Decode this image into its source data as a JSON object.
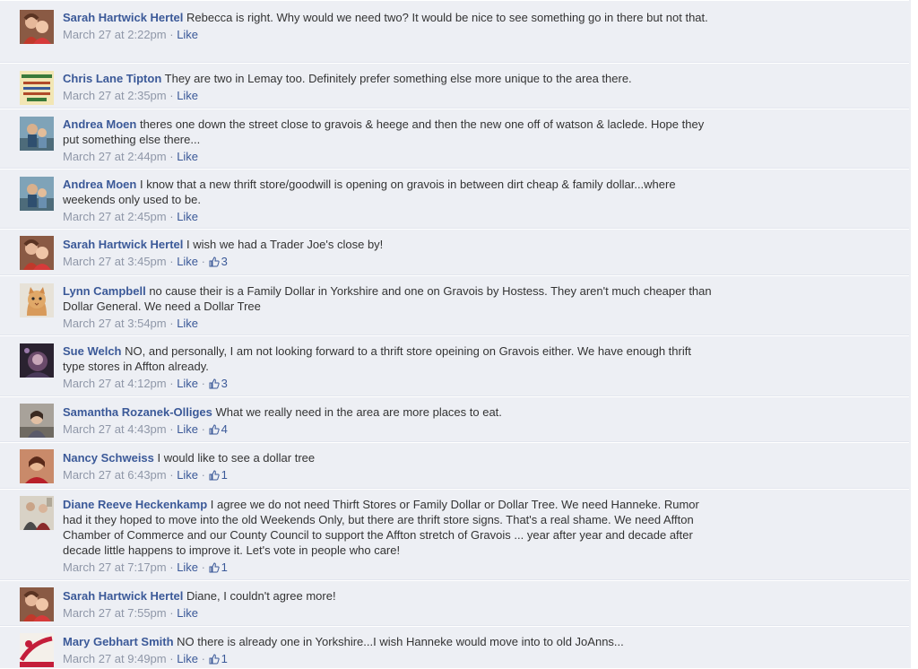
{
  "colors": {
    "background": "#edeff4",
    "author": "#3b5998",
    "text": "#333333",
    "meta": "#8f97a8"
  },
  "comments": [
    {
      "author": "Sarah Hartwick Hertel",
      "text": "Rebecca is right. Why would we need two? It would be nice to see something go in there but not that.",
      "time": "March 27 at 2:22pm",
      "sep": " · ",
      "like": "Like",
      "likes": "",
      "avatar": "sarah-avatar"
    },
    {
      "author": "Chris Lane Tipton",
      "text": "They are two in Lemay too. Definitely prefer something else more unique to the area there.",
      "time": "March 27 at 2:35pm",
      "sep": " · ",
      "like": "Like",
      "likes": "",
      "avatar": "chris-avatar"
    },
    {
      "author": "Andrea Moen",
      "text": "theres one down the street close to gravois & heege and then the new one off of watson & laclede. Hope they put something else there...",
      "time": "March 27 at 2:44pm",
      "sep": " · ",
      "like": "Like",
      "likes": "",
      "avatar": "andrea-avatar"
    },
    {
      "author": "Andrea Moen",
      "text": "I know that a new thrift store/goodwill is opening on gravois in between dirt cheap & family dollar...where weekends only used to be.",
      "time": "March 27 at 2:45pm",
      "sep": " · ",
      "like": "Like",
      "likes": "",
      "avatar": "andrea-avatar"
    },
    {
      "author": "Sarah Hartwick Hertel",
      "text": "I wish we had a Trader Joe's close by!",
      "time": "March 27 at 3:45pm",
      "sep": " · ",
      "like": "Like",
      "likes": "3",
      "avatar": "sarah-avatar"
    },
    {
      "author": "Lynn Campbell",
      "text": "no cause their is a Family Dollar in Yorkshire and one on Gravois by Hostess. They aren't much cheaper than Dollar General. We need a Dollar Tree",
      "time": "March 27 at 3:54pm",
      "sep": " · ",
      "like": "Like",
      "likes": "",
      "avatar": "lynn-avatar"
    },
    {
      "author": "Sue Welch",
      "text": "NO, and personally, I am not looking forward to a thrift store opeining on Gravois either. We have enough thrift type stores in Affton already.",
      "time": "March 27 at 4:12pm",
      "sep": " · ",
      "like": "Like",
      "likes": "3",
      "avatar": "sue-avatar"
    },
    {
      "author": "Samantha Rozanek-Olliges",
      "text": "What we really need in the area are more places to eat.",
      "time": "March 27 at 4:43pm",
      "sep": " · ",
      "like": "Like",
      "likes": "4",
      "avatar": "samantha-avatar"
    },
    {
      "author": "Nancy Schweiss",
      "text": "I would like to see a dollar tree",
      "time": "March 27 at 6:43pm",
      "sep": " · ",
      "like": "Like",
      "likes": "1",
      "avatar": "nancy-avatar"
    },
    {
      "author": "Diane Reeve Heckenkamp",
      "text": "I agree we do not need Thirft Stores or Family Dollar or Dollar Tree. We need Hanneke. Rumor had it they hoped to move into the old Weekends Only, but there are thrift store signs. That's a real shame. We need Affton Chamber of Commerce and our County Council to support the Affton stretch of Gravois ... year after year and decade after decade little happens to improve it. Let's vote in people who care!",
      "time": "March 27 at 7:17pm",
      "sep": " · ",
      "like": "Like",
      "likes": "1",
      "avatar": "diane-avatar"
    },
    {
      "author": "Sarah Hartwick Hertel",
      "text": "Diane, I couldn't agree more!",
      "time": "March 27 at 7:55pm",
      "sep": " · ",
      "like": "Like",
      "likes": "",
      "avatar": "sarah-avatar"
    },
    {
      "author": "Mary Gebhart Smith",
      "text": "NO there is already one in Yorkshire...I wish Hanneke would move into to old JoAnns...",
      "time": "March 27 at 9:49pm",
      "sep": " · ",
      "like": "Like",
      "likes": "1",
      "avatar": "mary-avatar"
    }
  ]
}
